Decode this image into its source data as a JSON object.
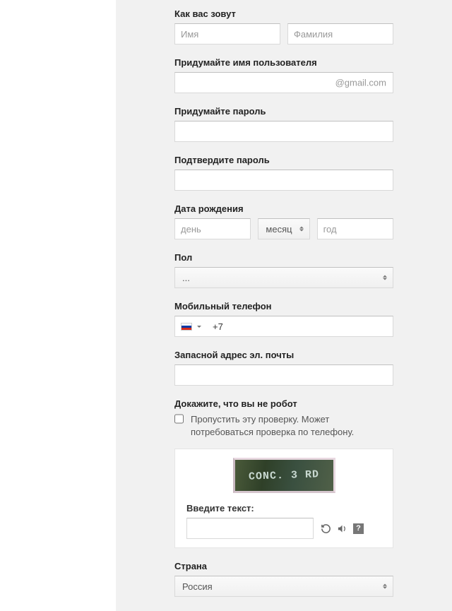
{
  "name": {
    "label": "Как вас зовут",
    "first_placeholder": "Имя",
    "last_placeholder": "Фамилия"
  },
  "username": {
    "label": "Придумайте имя пользователя",
    "suffix": "@gmail.com"
  },
  "password": {
    "label": "Придумайте пароль"
  },
  "confirm_password": {
    "label": "Подтвердите пароль"
  },
  "dob": {
    "label": "Дата рождения",
    "day_placeholder": "день",
    "month_placeholder": "месяц",
    "year_placeholder": "год"
  },
  "gender": {
    "label": "Пол",
    "selected": "..."
  },
  "phone": {
    "label": "Мобильный телефон",
    "prefix": "+7"
  },
  "recovery_email": {
    "label": "Запасной адрес эл. почты"
  },
  "captcha": {
    "label": "Докажите, что вы не робот",
    "skip_text": "Пропустить эту проверку. Может потребоваться проверка по телефону.",
    "input_label": "Введите текст:",
    "image_text": "CONC. 3 RD",
    "help_char": "?"
  },
  "country": {
    "label": "Страна",
    "selected": "Россия"
  }
}
